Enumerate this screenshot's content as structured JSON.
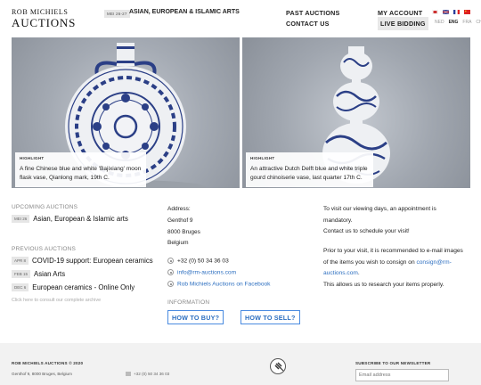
{
  "header": {
    "logo_line1": "ROB MICHIELS",
    "logo_line2": "AUCTIONS",
    "current_auction_date": "MEI 26-27",
    "current_auction_title": "ASIAN, EUROPEAN & ISLAMIC ARTS",
    "nav_past": "PAST AUCTIONS",
    "nav_contact": "CONTACT US",
    "nav_account": "MY ACCOUNT",
    "nav_live": "LIVE BIDDING",
    "languages": [
      {
        "code": "NED",
        "active": false
      },
      {
        "code": "ENG",
        "active": true
      },
      {
        "code": "FRA",
        "active": false
      },
      {
        "code": "CH",
        "active": false
      }
    ]
  },
  "hero": [
    {
      "label": "HIGHLIGHT",
      "text_line1": "A fine Chinese blue and white 'Bajixiang' moon",
      "text_line2": "flask vase, Qianlong mark, 19th C."
    },
    {
      "label": "HIGHLIGHT",
      "text_line1": "An attractive Dutch Delft blue and white triple",
      "text_line2": "gourd chinoiserie vase, last quarter 17th C."
    }
  ],
  "upcoming": {
    "title": "UPCOMING AUCTIONS",
    "items": [
      {
        "date": "MEI 26",
        "name": "Asian, European & Islamic arts"
      }
    ]
  },
  "previous": {
    "title": "PREVIOUS AUCTIONS",
    "items": [
      {
        "date": "APR 8",
        "name": "COVID-19 support: European ceramics"
      },
      {
        "date": "FEB 15",
        "name": "Asian Arts"
      },
      {
        "date": "DEC 6",
        "name": "European ceramics - Online Only"
      }
    ],
    "archive_link": "Click here to consult our complete archive"
  },
  "address": {
    "label": "Address:",
    "street": "Genthof 9",
    "city": "8000 Bruges",
    "country": "Belgium",
    "phone": "+32 (0) 50 34 36 03",
    "email": "info@rm-auctions.com",
    "facebook": "Rob Michiels Auctions on Facebook"
  },
  "information": {
    "title": "INFORMATION",
    "how_to_buy": "HOW TO BUY?",
    "how_to_sell": "HOW TO SELL?"
  },
  "visit": {
    "line1": "To visit our viewing days, an appointment is",
    "line2": "mandatory.",
    "line3": "Contact us to schedule your visit!",
    "line4": "Prior to your visit, it is recommended to e-mail images",
    "line5_prefix": "of the items you wish to consign on ",
    "line5_link": "consign@rm-",
    "line6_link": "auctions.com",
    "line6_suffix": ".",
    "line7": "This allows us to research your items properly."
  },
  "footer": {
    "copyright": "ROB MICHIELS AUCTIONS © 2020",
    "address": "Genthof 9, 8000 Bruges, Belgium",
    "phone": "+32 (0) 50 34 36 03",
    "newsletter_title": "SUBSCRIBE TO OUR NEWSLETTER",
    "email_placeholder": "Email address"
  },
  "colors": {
    "link_blue": "#2d6fc0",
    "button_border": "#4a8be0",
    "date_badge_bg": "#e6e6e6",
    "footer_bg": "#f2f2f2"
  }
}
